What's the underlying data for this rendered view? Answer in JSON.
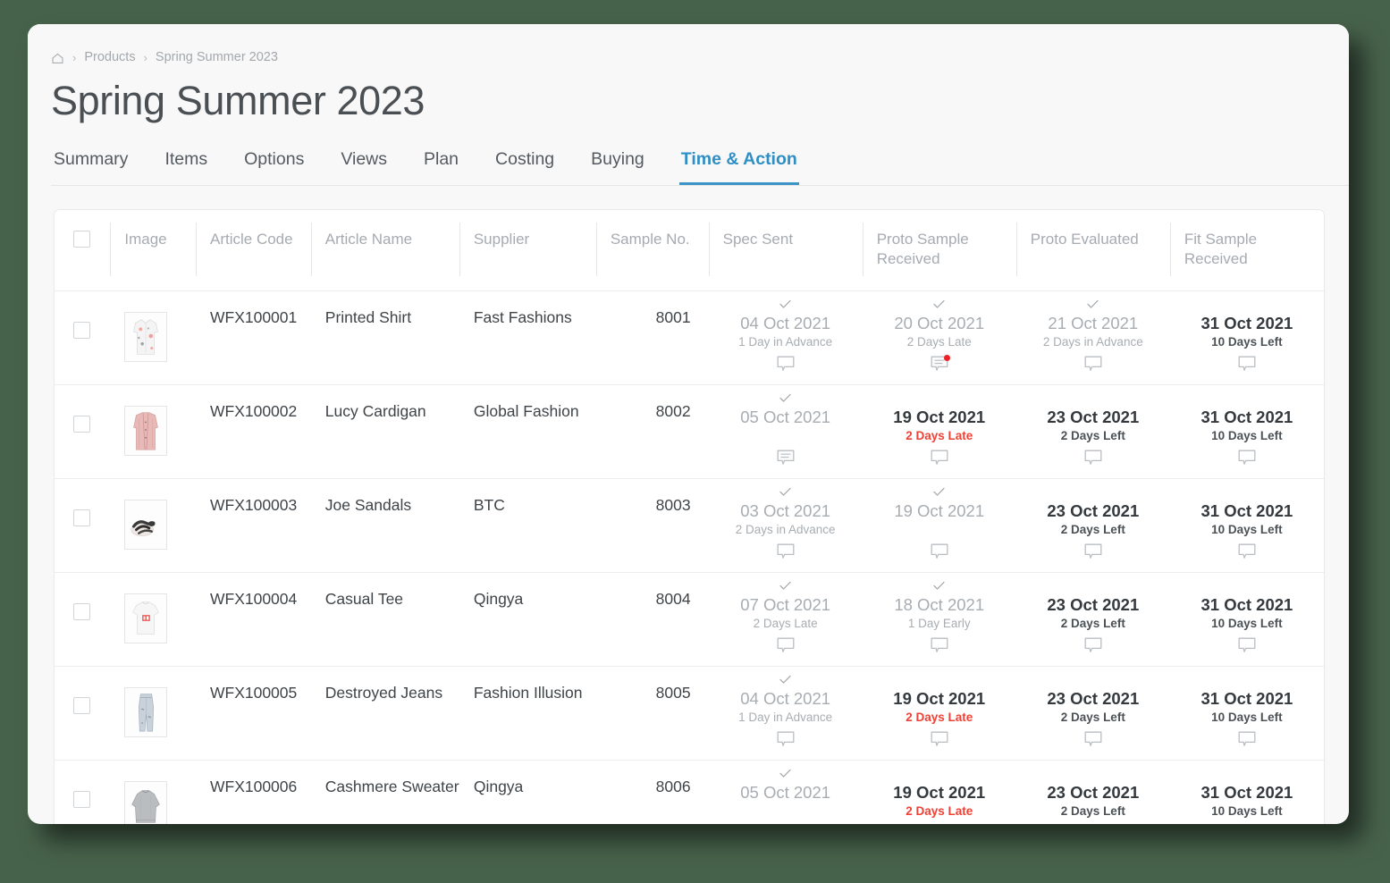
{
  "breadcrumb": {
    "home_icon": "home-icon",
    "separator": "›",
    "items": [
      "Products",
      "Spring Summer 2023"
    ]
  },
  "page_title": "Spring Summer 2023",
  "tabs": [
    {
      "label": "Summary",
      "active": false
    },
    {
      "label": "Items",
      "active": false
    },
    {
      "label": "Options",
      "active": false
    },
    {
      "label": "Views",
      "active": false
    },
    {
      "label": "Plan",
      "active": false
    },
    {
      "label": "Costing",
      "active": false
    },
    {
      "label": "Buying",
      "active": false
    },
    {
      "label": "Time & Action",
      "active": true
    }
  ],
  "accent_color": "#3b93c6",
  "late_color": "#ef4136",
  "table": {
    "headers": {
      "select_all": "",
      "image": "Image",
      "article_code": "Article Code",
      "article_name": "Article Name",
      "supplier": "Supplier",
      "sample_no": "Sample No.",
      "spec_sent": "Spec Sent",
      "proto_sample_received": "Proto Sample Received",
      "proto_evaluated": "Proto Evaluated",
      "fit_sample_received": "Fit Sample Received"
    },
    "rows": [
      {
        "article_code": "WFX100001",
        "article_name": "Printed Shirt",
        "supplier": "Fast Fashions",
        "sample_no": "8001",
        "thumb": "printed-shirt",
        "spec_sent": {
          "date": "04 Oct 2021",
          "sub": "1 Day in Advance",
          "done": true,
          "late": false,
          "comment": "empty",
          "unread": false
        },
        "proto_sample_received": {
          "date": "20 Oct 2021",
          "sub": "2 Days Late",
          "done": true,
          "late": false,
          "comment": "filled",
          "unread": true
        },
        "proto_evaluated": {
          "date": "21 Oct 2021",
          "sub": "2 Days in Advance",
          "done": true,
          "late": false,
          "comment": "empty",
          "unread": false
        },
        "fit_sample_received": {
          "date": "31 Oct 2021",
          "sub": "10 Days Left",
          "done": false,
          "late": false,
          "comment": "empty",
          "unread": false
        }
      },
      {
        "article_code": "WFX100002",
        "article_name": "Lucy Cardigan",
        "supplier": "Global Fashion",
        "sample_no": "8002",
        "thumb": "cardigan",
        "spec_sent": {
          "date": "05 Oct 2021",
          "sub": "",
          "done": true,
          "late": false,
          "comment": "filled",
          "unread": false
        },
        "proto_sample_received": {
          "date": "19 Oct 2021",
          "sub": "2 Days Late",
          "done": false,
          "late": true,
          "comment": "empty",
          "unread": false
        },
        "proto_evaluated": {
          "date": "23 Oct 2021",
          "sub": "2 Days Left",
          "done": false,
          "late": false,
          "comment": "empty",
          "unread": false
        },
        "fit_sample_received": {
          "date": "31 Oct 2021",
          "sub": "10 Days Left",
          "done": false,
          "late": false,
          "comment": "empty",
          "unread": false
        }
      },
      {
        "article_code": "WFX100003",
        "article_name": "Joe Sandals",
        "supplier": "BTC",
        "sample_no": "8003",
        "thumb": "sandals",
        "spec_sent": {
          "date": "03 Oct 2021",
          "sub": "2 Days in Advance",
          "done": true,
          "late": false,
          "comment": "empty",
          "unread": false
        },
        "proto_sample_received": {
          "date": "19 Oct 2021",
          "sub": "",
          "done": true,
          "late": false,
          "comment": "empty",
          "unread": false
        },
        "proto_evaluated": {
          "date": "23 Oct 2021",
          "sub": "2 Days Left",
          "done": false,
          "late": false,
          "comment": "empty",
          "unread": false
        },
        "fit_sample_received": {
          "date": "31 Oct 2021",
          "sub": "10 Days Left",
          "done": false,
          "late": false,
          "comment": "empty",
          "unread": false
        }
      },
      {
        "article_code": "WFX100004",
        "article_name": "Casual Tee",
        "supplier": "Qingya",
        "sample_no": "8004",
        "thumb": "tee",
        "spec_sent": {
          "date": "07 Oct 2021",
          "sub": "2 Days Late",
          "done": true,
          "late": false,
          "comment": "empty",
          "unread": false
        },
        "proto_sample_received": {
          "date": "18 Oct 2021",
          "sub": "1 Day Early",
          "done": true,
          "late": false,
          "comment": "empty",
          "unread": false
        },
        "proto_evaluated": {
          "date": "23 Oct 2021",
          "sub": "2 Days Left",
          "done": false,
          "late": false,
          "comment": "empty",
          "unread": false
        },
        "fit_sample_received": {
          "date": "31 Oct 2021",
          "sub": "10 Days Left",
          "done": false,
          "late": false,
          "comment": "empty",
          "unread": false
        }
      },
      {
        "article_code": "WFX100005",
        "article_name": "Destroyed Jeans",
        "supplier": "Fashion Illusion",
        "sample_no": "8005",
        "thumb": "jeans",
        "spec_sent": {
          "date": "04 Oct 2021",
          "sub": "1 Day in Advance",
          "done": true,
          "late": false,
          "comment": "empty",
          "unread": false
        },
        "proto_sample_received": {
          "date": "19 Oct 2021",
          "sub": "2 Days Late",
          "done": false,
          "late": true,
          "comment": "empty",
          "unread": false
        },
        "proto_evaluated": {
          "date": "23 Oct 2021",
          "sub": "2 Days Left",
          "done": false,
          "late": false,
          "comment": "empty",
          "unread": false
        },
        "fit_sample_received": {
          "date": "31 Oct 2021",
          "sub": "10 Days Left",
          "done": false,
          "late": false,
          "comment": "empty",
          "unread": false
        }
      },
      {
        "article_code": "WFX100006",
        "article_name": "Cashmere Sweater",
        "supplier": "Qingya",
        "sample_no": "8006",
        "thumb": "sweater",
        "spec_sent": {
          "date": "05 Oct 2021",
          "sub": "",
          "done": true,
          "late": false,
          "comment": "empty",
          "unread": false
        },
        "proto_sample_received": {
          "date": "19 Oct 2021",
          "sub": "2 Days Late",
          "done": false,
          "late": true,
          "comment": "empty",
          "unread": false
        },
        "proto_evaluated": {
          "date": "23 Oct 2021",
          "sub": "2 Days Left",
          "done": false,
          "late": false,
          "comment": "empty",
          "unread": false
        },
        "fit_sample_received": {
          "date": "31 Oct 2021",
          "sub": "10 Days Left",
          "done": false,
          "late": false,
          "comment": "empty",
          "unread": false
        }
      }
    ]
  }
}
